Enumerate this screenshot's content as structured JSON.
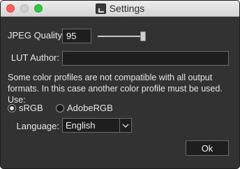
{
  "window": {
    "title": "Settings",
    "app_icon": "app-icon"
  },
  "jpeg_quality": {
    "label": "JPEG Quality:",
    "value": "95",
    "slider_fraction": 0.95
  },
  "lut_author": {
    "label": "LUT Author:",
    "value": ""
  },
  "info_text": "Some color profiles are not compatible with all output formats. In this case another color profile must be used. Use:",
  "color_profile": {
    "options": [
      {
        "label": "sRGB",
        "checked": true
      },
      {
        "label": "AdobeRGB",
        "checked": false
      }
    ]
  },
  "language": {
    "label": "Language:",
    "selected": "English",
    "arrow_icon": "chevron-down-icon"
  },
  "ok_button": {
    "label": "Ok"
  },
  "colors": {
    "background": "#323232",
    "text": "#e6e6e6",
    "field_background": "#1e1e1e",
    "close": "#fc5f57",
    "minimize": "#d0d0d0",
    "maximize": "#2bc840"
  }
}
